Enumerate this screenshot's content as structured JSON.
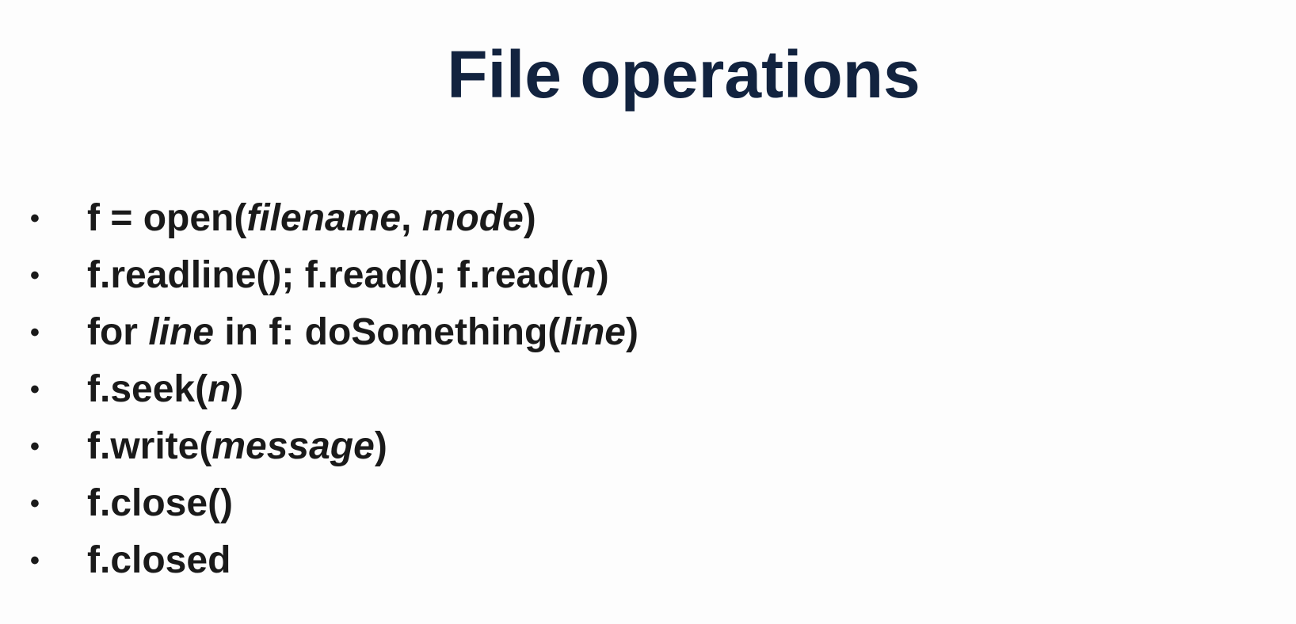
{
  "slide": {
    "title": "File operations",
    "bullet_symbol": "•",
    "items": [
      {
        "parts": [
          {
            "t": "f = open(",
            "i": false
          },
          {
            "t": "filename",
            "i": true
          },
          {
            "t": ", ",
            "i": false
          },
          {
            "t": "mode",
            "i": true
          },
          {
            "t": ")",
            "i": false
          }
        ]
      },
      {
        "parts": [
          {
            "t": "f.readline(); f.read(); f.read(",
            "i": false
          },
          {
            "t": "n",
            "i": true
          },
          {
            "t": ")",
            "i": false
          }
        ]
      },
      {
        "parts": [
          {
            "t": "for ",
            "i": false
          },
          {
            "t": "line",
            "i": true
          },
          {
            "t": " in f: doSomething(",
            "i": false
          },
          {
            "t": "line",
            "i": true
          },
          {
            "t": ")",
            "i": false
          }
        ]
      },
      {
        "parts": [
          {
            "t": "f.seek(",
            "i": false
          },
          {
            "t": "n",
            "i": true
          },
          {
            "t": ")",
            "i": false
          }
        ]
      },
      {
        "parts": [
          {
            "t": "f.write(",
            "i": false
          },
          {
            "t": "message",
            "i": true
          },
          {
            "t": ")",
            "i": false
          }
        ]
      },
      {
        "parts": [
          {
            "t": "f.close()",
            "i": false
          }
        ]
      },
      {
        "parts": [
          {
            "t": "f.closed",
            "i": false
          }
        ]
      }
    ],
    "colors": {
      "title": "#12233f",
      "text": "#1a1a1a",
      "background": "#fdfdfd"
    }
  }
}
